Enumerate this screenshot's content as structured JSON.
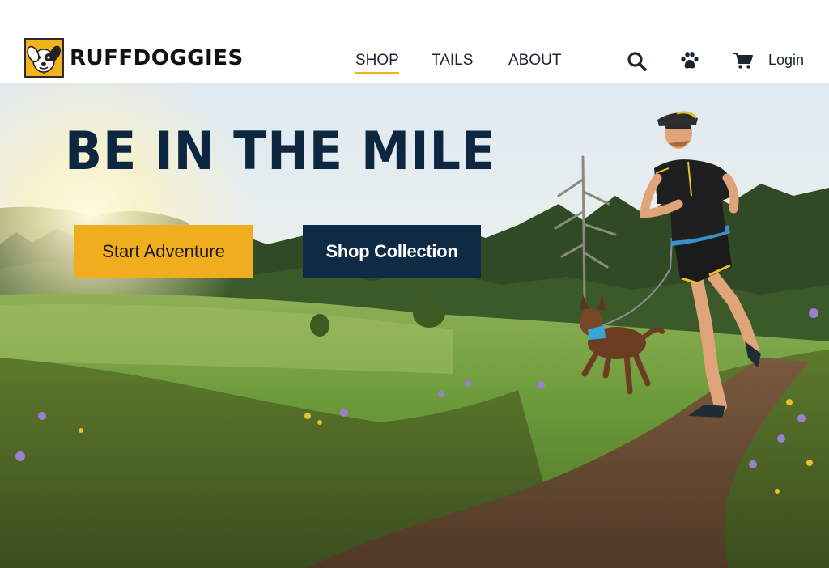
{
  "brand": {
    "name": "RUFFDOGGIES",
    "logo_icon": "dog-face-logo-icon"
  },
  "nav": {
    "items": [
      {
        "label": "SHOP",
        "active": true
      },
      {
        "label": "TAILS",
        "active": false
      },
      {
        "label": "ABOUT",
        "active": false
      }
    ]
  },
  "header_actions": {
    "icons": [
      "search-icon",
      "paw-icon",
      "cart-icon"
    ],
    "login_label": "Login"
  },
  "hero": {
    "title": "BE IN THE MILE",
    "primary_cta": "Start Adventure",
    "secondary_cta": "Shop Collection",
    "image": "runner-with-dog-on-trail-photo"
  },
  "colors": {
    "accent": "#f0ad1d",
    "navy": "#0f2a44",
    "title": "#0d2740",
    "text": "#1b2530"
  }
}
